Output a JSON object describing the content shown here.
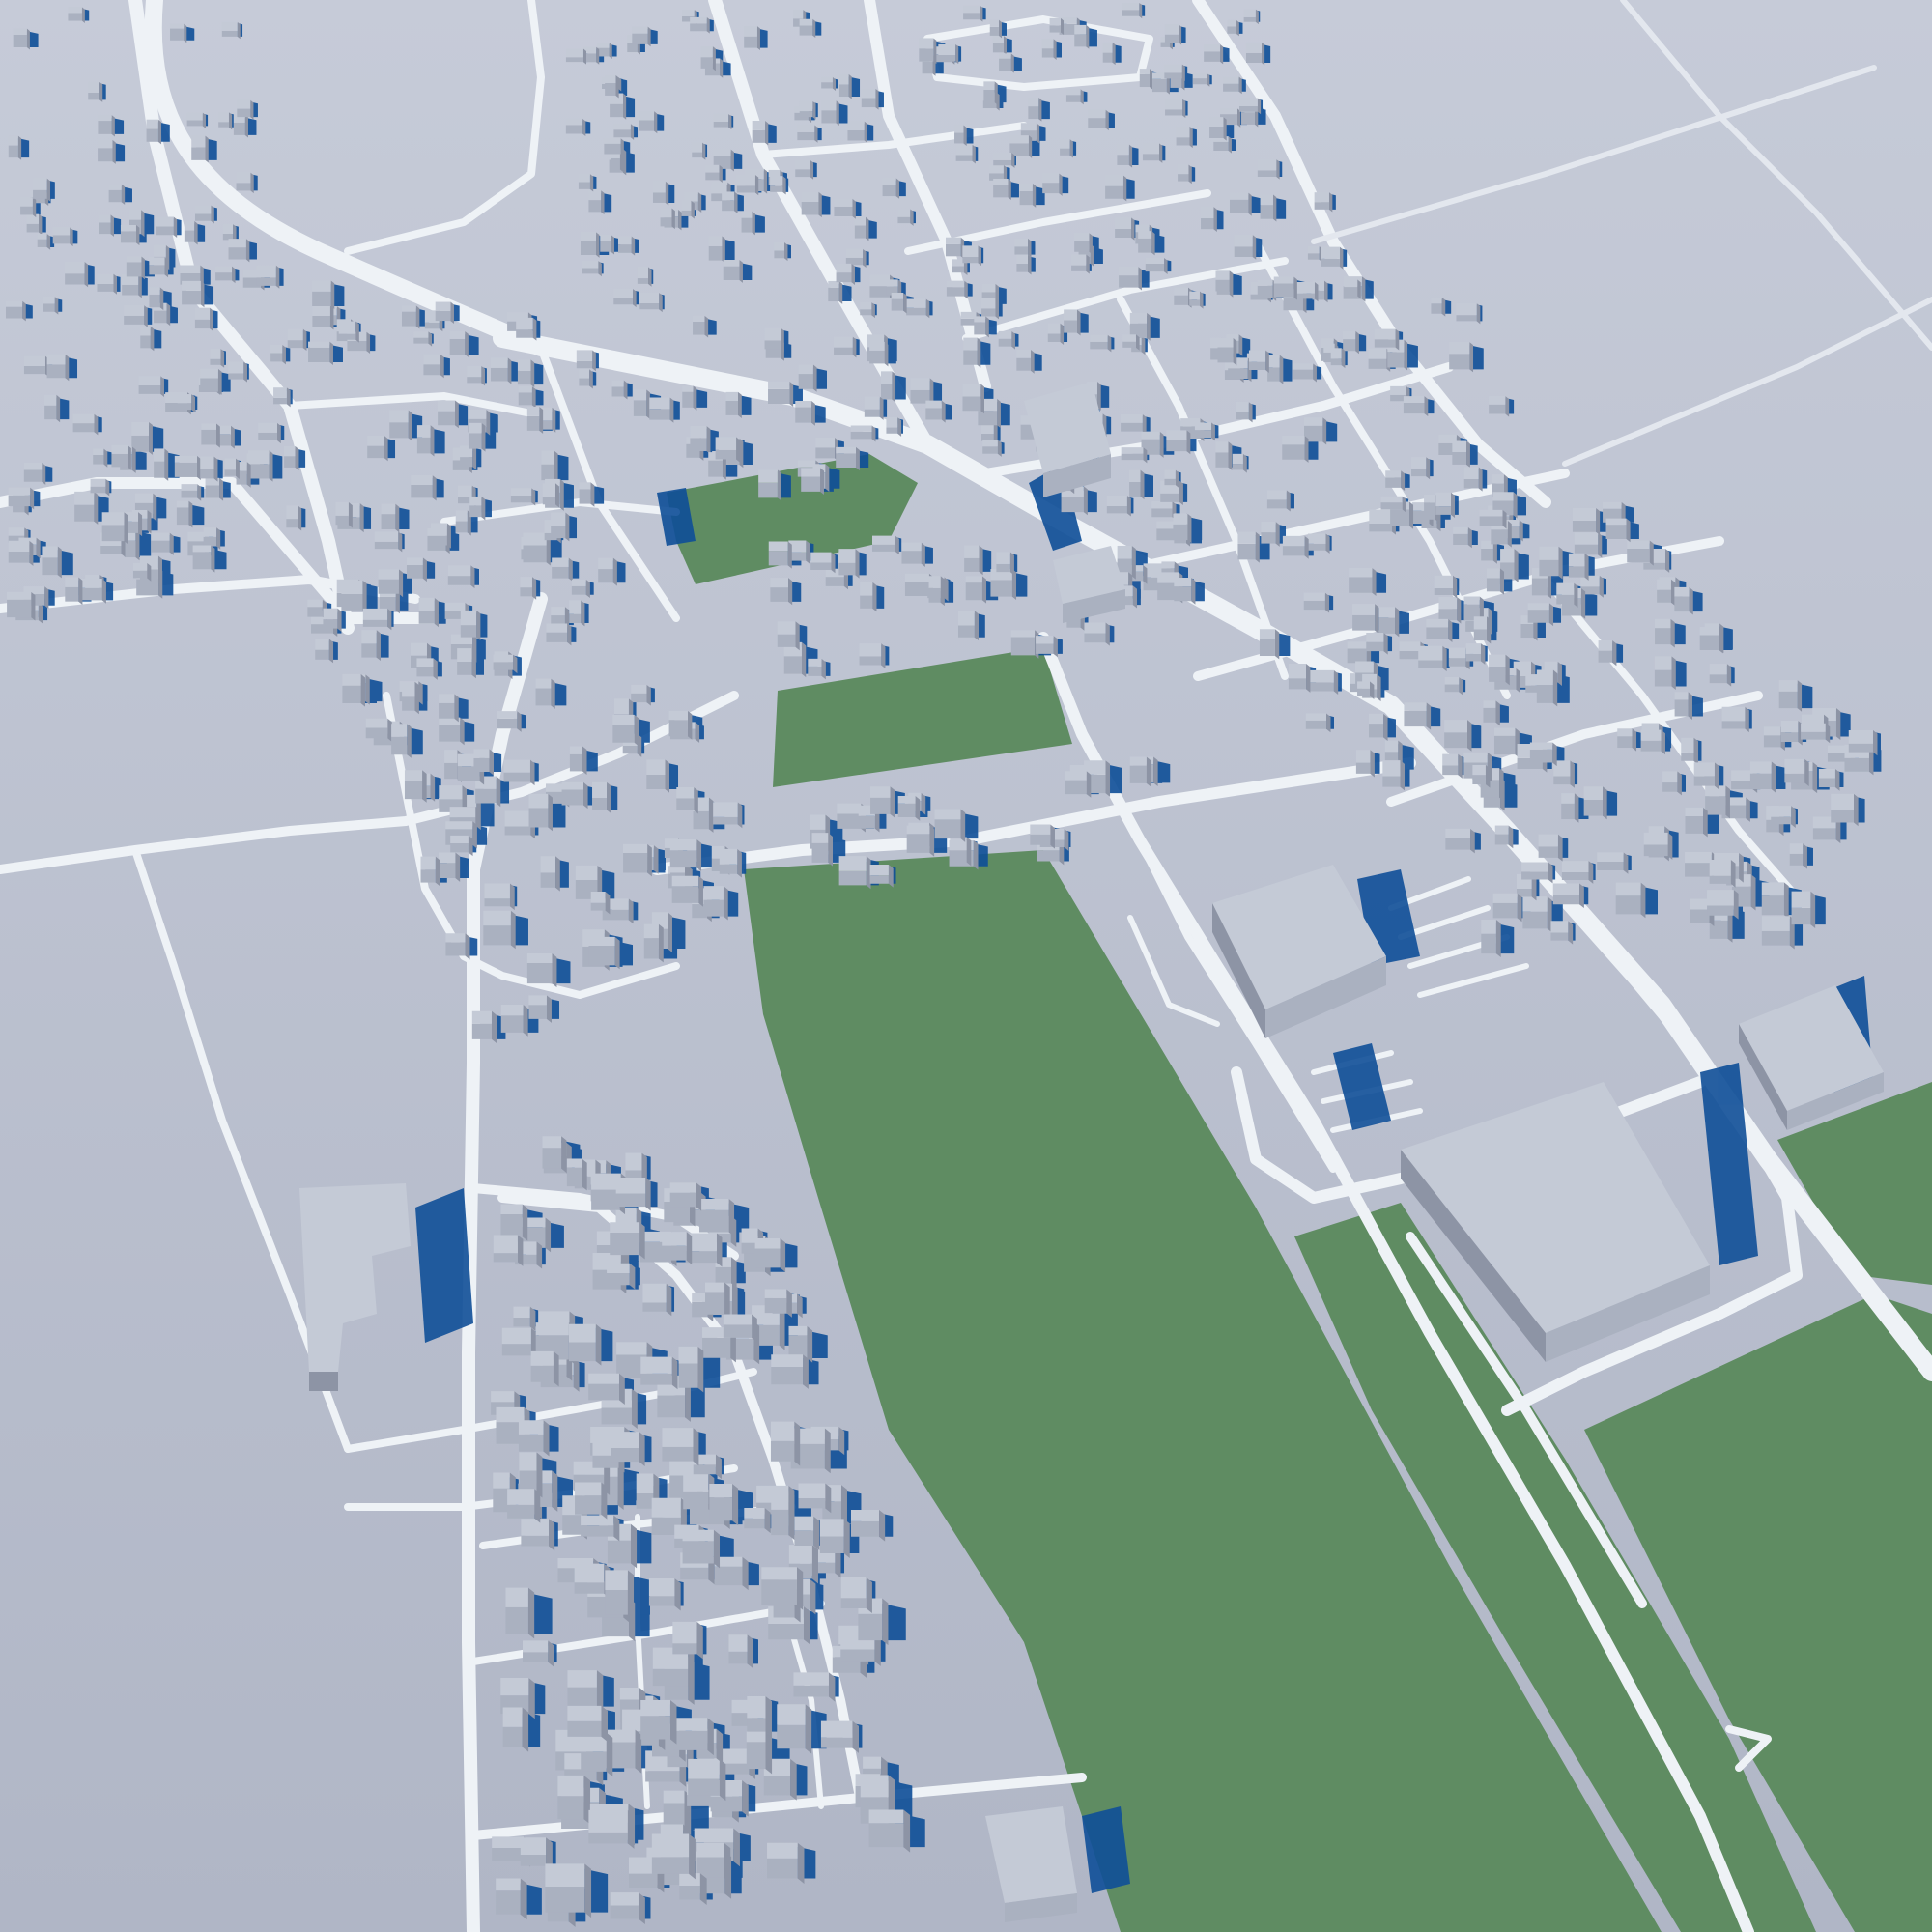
{
  "scene": {
    "kind": "3d-city-model-render",
    "view": "aerial-oblique",
    "labels_present": false
  },
  "legend": [],
  "colors": {
    "ground": "#b7bdcc",
    "ground_light": "#c9ceda",
    "road": "#eef2f6",
    "road_edge": "#dfe4ec",
    "green_area": "#5f8c62",
    "green_area_edge": "#557e58",
    "building_top": "#c4cad6",
    "building_side_light": "#aab1c0",
    "building_side_dark": "#8d94a5",
    "shadow": "#0f4f98"
  },
  "map_features": {
    "green_areas": [
      {
        "name": "green-area-small-north",
        "kind": "field"
      },
      {
        "name": "green-area-mid",
        "kind": "field"
      },
      {
        "name": "green-area-large-central",
        "kind": "field"
      },
      {
        "name": "green-area-strip-east",
        "kind": "field"
      },
      {
        "name": "green-area-southeast",
        "kind": "field"
      },
      {
        "name": "green-area-far-east",
        "kind": "field"
      }
    ],
    "large_buildings": [
      {
        "name": "warehouse-central",
        "kind": "industrial"
      },
      {
        "name": "warehouse-southeast",
        "kind": "industrial"
      },
      {
        "name": "warehouse-east-small",
        "kind": "industrial"
      },
      {
        "name": "hall-west",
        "kind": "institutional"
      },
      {
        "name": "hall-south",
        "kind": "industrial"
      }
    ]
  }
}
